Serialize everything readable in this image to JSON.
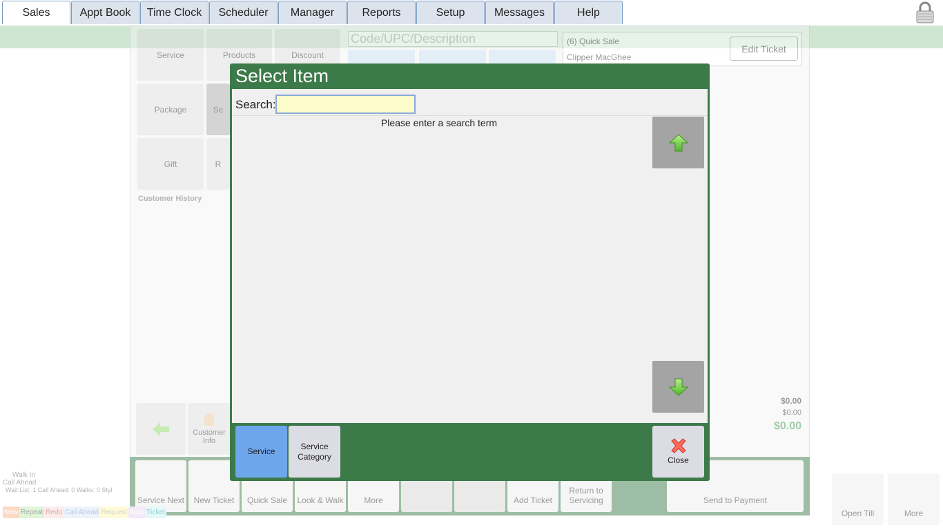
{
  "top_tabs": [
    {
      "label": "Sales",
      "active": true
    },
    {
      "label": "Appt Book"
    },
    {
      "label": "Time Clock"
    },
    {
      "label": "Scheduler"
    },
    {
      "label": "Manager"
    },
    {
      "label": "Reports"
    },
    {
      "label": "Setup"
    },
    {
      "label": "Messages"
    },
    {
      "label": "Help"
    }
  ],
  "background": {
    "item_tiles": [
      "Service",
      "Products",
      "Discount",
      "Package",
      "Se",
      "Gift",
      "R"
    ],
    "code_placeholder": "Code/UPC/Description",
    "ticket": {
      "line1": "(6) Quick Sale",
      "line2": "Clipper MacGhee",
      "edit_label": "Edit Ticket"
    },
    "customer_history": "Customer History",
    "totals": {
      "total_value": "$0.00",
      "tax_value": "$0.00",
      "grand_value": "$0.00"
    },
    "customer_info": "Customer Info",
    "bottom_buttons": [
      "Service Next",
      "New Ticket",
      "Quick Sale",
      "Look & Walk",
      "More",
      "Add Ticket",
      "Return to Servicing",
      "Send to Payment"
    ],
    "right_buttons": [
      "Open Till",
      "More"
    ],
    "walkin": {
      "line1": "Walk In",
      "line2": "Call Ahead",
      "stats": "Wait List: 1   Call Ahead: 0   Walks: 0   Styl"
    },
    "legend": [
      "New",
      "Repeat",
      "Redo",
      "Call Ahead",
      "Request",
      "Appt",
      "Ticket"
    ]
  },
  "modal": {
    "title": "Select Item",
    "search_label": "Search:",
    "search_value": "",
    "empty_message": "Please enter a search term",
    "type_buttons": [
      {
        "label": "Service",
        "selected": true
      },
      {
        "label": "Service Category",
        "selected": false
      }
    ],
    "close_label": "Close"
  },
  "colors": {
    "accent_green": "#3c7a4a",
    "selected_blue": "#6ea6ec",
    "search_bg": "#fffccc"
  }
}
